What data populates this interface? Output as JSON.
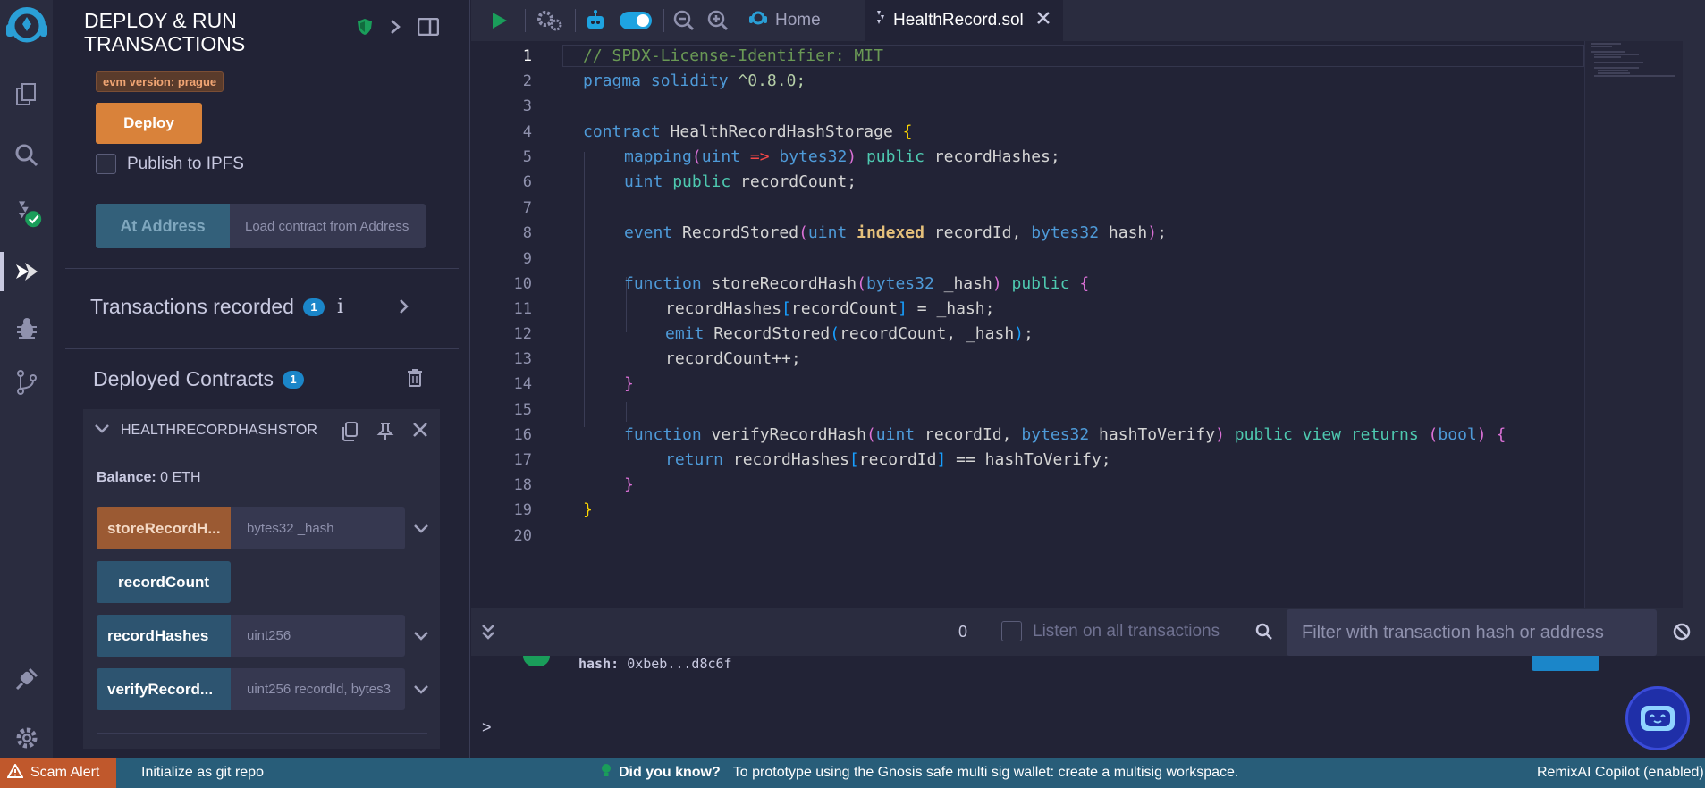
{
  "panel": {
    "title_line1": "DEPLOY & RUN",
    "title_line2": "TRANSACTIONS",
    "evm_version": "evm version: prague",
    "deploy_label": "Deploy",
    "publish_ipfs_label": "Publish to IPFS",
    "at_address_label": "At Address",
    "at_address_placeholder": "Load contract from Address",
    "transactions_recorded_label": "Transactions recorded",
    "transactions_recorded_count": "1",
    "deployed_contracts_label": "Deployed Contracts",
    "deployed_contracts_count": "1",
    "contract": {
      "name": "HEALTHRECORDHASHSTORAGE",
      "balance_label": "Balance:",
      "balance_value": "0 ETH",
      "functions": [
        {
          "label": "storeRecordH...",
          "input": "bytes32 _hash"
        },
        {
          "label": "recordCount",
          "input": ""
        },
        {
          "label": "recordHashes",
          "input": "uint256"
        },
        {
          "label": "verifyRecord...",
          "input": "uint256 recordId, bytes3"
        }
      ]
    }
  },
  "toolbar": {
    "home_tab": "Home",
    "file_tab": "HealthRecord.sol"
  },
  "editor": {
    "line_numbers": [
      "1",
      "2",
      "3",
      "4",
      "5",
      "6",
      "7",
      "8",
      "9",
      "10",
      "11",
      "12",
      "13",
      "14",
      "15",
      "16",
      "17",
      "18",
      "19",
      "20"
    ],
    "lines": {
      "l1": "// SPDX-License-Identifier: MIT",
      "l2_kw": "pragma solidity",
      "l2_ver": " ^0.8.0;",
      "l4_kw": "contract",
      "l4_name": " HealthRecordHashStorage ",
      "l5_a": "mapping",
      "l5_b": "uint",
      "l5_c": " => ",
      "l5_d": "bytes32",
      "l5_e": " public",
      "l5_f": " recordHashes;",
      "l6_a": "uint",
      "l6_b": " public",
      "l6_c": " recordCount;",
      "l8_a": "event",
      "l8_b": " RecordStored",
      "l8_c": "uint",
      "l8_d": " indexed",
      "l8_e": " recordId, ",
      "l8_f": "bytes32",
      "l8_g": " hash",
      "l10_a": "function",
      "l10_b": " storeRecordHash",
      "l10_c": "bytes32",
      "l10_d": " _hash",
      "l10_e": " public ",
      "l11": "recordHashes",
      "l11_b": "recordCount",
      "l11_c": " = _hash;",
      "l12_a": "emit",
      "l12_b": " RecordStored",
      "l12_c": "recordCount, _hash",
      "l13": "recordCount++;",
      "l16_a": "function",
      "l16_b": " verifyRecordHash",
      "l16_c": "uint",
      "l16_d": " recordId, ",
      "l16_e": "bytes32",
      "l16_f": " hashToVerify",
      "l16_g": " public",
      "l16_h": " view",
      "l16_i": " returns ",
      "l16_j": "bool",
      "l17_a": "return",
      "l17_b": " recordHashes",
      "l17_c": "recordId",
      "l17_d": " == hashToVerify;"
    }
  },
  "terminal": {
    "tx_count": "0",
    "listen_label": "Listen on all transactions",
    "filter_placeholder": "Filter with transaction hash or address",
    "hash_label": "hash:",
    "hash_value": "0xbeb...d8c6f",
    "prompt": ">"
  },
  "status": {
    "scam_alert": "Scam Alert",
    "git_init": "Initialize as git repo",
    "did_you_know": "Did you know?",
    "tip": "To prototype using the Gnosis safe multi sig wallet: create a multisig workspace.",
    "copilot": "RemixAI Copilot (enabled)"
  },
  "colors": {
    "accent_orange": "#d9823a",
    "accent_blue": "#1b86c9",
    "status_bar": "#285d79",
    "scam_alert": "#c0582c"
  }
}
